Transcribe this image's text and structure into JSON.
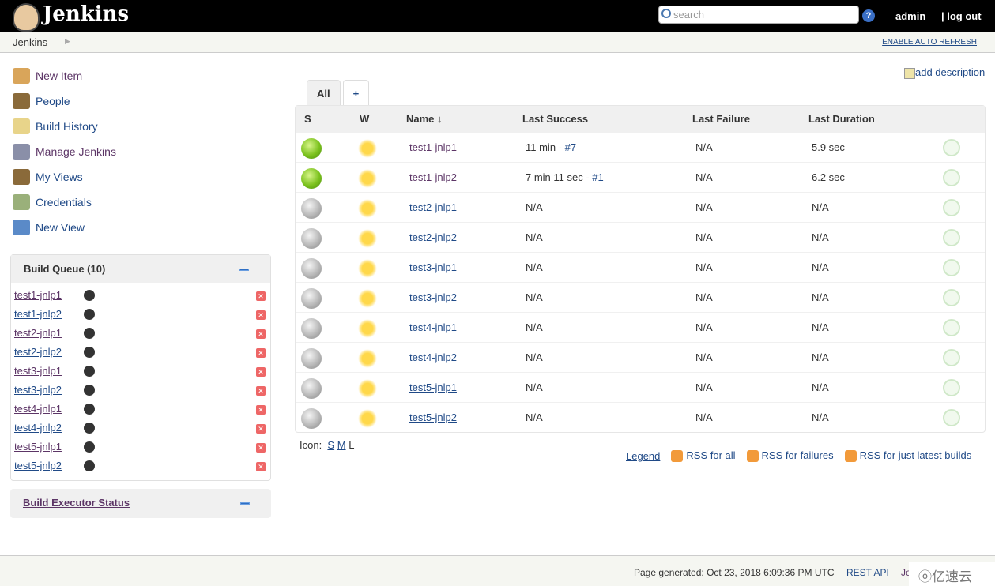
{
  "header": {
    "title": "Jenkins",
    "search_placeholder": "search",
    "help": "?",
    "user": "admin",
    "logout": "| log out"
  },
  "breadcrumb": {
    "root": "Jenkins",
    "auto_refresh": "ENABLE AUTO REFRESH"
  },
  "sidebar": {
    "items": [
      {
        "label": "New Item",
        "icon": "new-item-box-icon",
        "color": "#d9a55a"
      },
      {
        "label": "People",
        "icon": "people-icon",
        "color": "#8a6a3a"
      },
      {
        "label": "Build History",
        "icon": "notepad-icon",
        "color": "#e8d48a"
      },
      {
        "label": "Manage Jenkins",
        "icon": "gear-icon",
        "color": "#8a8fa8"
      },
      {
        "label": "My Views",
        "icon": "people-icon",
        "color": "#8a6a3a"
      },
      {
        "label": "Credentials",
        "icon": "keys-icon",
        "color": "#9ab07a"
      },
      {
        "label": "New View",
        "icon": "folder-icon",
        "color": "#5a8ac8"
      }
    ]
  },
  "build_queue": {
    "title": "Build Queue (10)",
    "items": [
      "test1-jnlp1",
      "test1-jnlp2",
      "test2-jnlp1",
      "test2-jnlp2",
      "test3-jnlp1",
      "test3-jnlp2",
      "test4-jnlp1",
      "test4-jnlp2",
      "test5-jnlp1",
      "test5-jnlp2"
    ]
  },
  "executor": {
    "title": "Build Executor Status"
  },
  "add_description": "add description",
  "tabs": [
    {
      "label": "All"
    },
    {
      "label": "+"
    }
  ],
  "table": {
    "headers": [
      "S",
      "W",
      "Name  ↓",
      "Last Success",
      "Last Failure",
      "Last Duration"
    ],
    "rows": [
      {
        "status": "success",
        "name": "test1-jnlp1",
        "success": "11 min - ",
        "build": "#7",
        "failure": "N/A",
        "duration": "5.9 sec"
      },
      {
        "status": "success",
        "name": "test1-jnlp2",
        "success": "7 min 11 sec - ",
        "build": "#1",
        "failure": "N/A",
        "duration": "6.2 sec"
      },
      {
        "status": "notbuilt",
        "name": "test2-jnlp1",
        "success": "N/A",
        "build": "",
        "failure": "N/A",
        "duration": "N/A"
      },
      {
        "status": "notbuilt",
        "name": "test2-jnlp2",
        "success": "N/A",
        "build": "",
        "failure": "N/A",
        "duration": "N/A"
      },
      {
        "status": "notbuilt",
        "name": "test3-jnlp1",
        "success": "N/A",
        "build": "",
        "failure": "N/A",
        "duration": "N/A"
      },
      {
        "status": "notbuilt",
        "name": "test3-jnlp2",
        "success": "N/A",
        "build": "",
        "failure": "N/A",
        "duration": "N/A"
      },
      {
        "status": "notbuilt",
        "name": "test4-jnlp1",
        "success": "N/A",
        "build": "",
        "failure": "N/A",
        "duration": "N/A"
      },
      {
        "status": "notbuilt",
        "name": "test4-jnlp2",
        "success": "N/A",
        "build": "",
        "failure": "N/A",
        "duration": "N/A"
      },
      {
        "status": "notbuilt",
        "name": "test5-jnlp1",
        "success": "N/A",
        "build": "",
        "failure": "N/A",
        "duration": "N/A"
      },
      {
        "status": "notbuilt",
        "name": "test5-jnlp2",
        "success": "N/A",
        "build": "",
        "failure": "N/A",
        "duration": "N/A"
      }
    ]
  },
  "icon_size": {
    "label": "Icon:",
    "options": [
      "S",
      "M",
      "L"
    ]
  },
  "links": [
    "Legend",
    "RSS for all",
    "RSS for failures",
    "RSS for just latest builds"
  ],
  "footer": {
    "generated": "Page generated: Oct 23, 2018 6:09:36 PM UTC",
    "rest_api": "REST API",
    "jenkins_ver": "Je"
  },
  "watermark": "亿速云"
}
